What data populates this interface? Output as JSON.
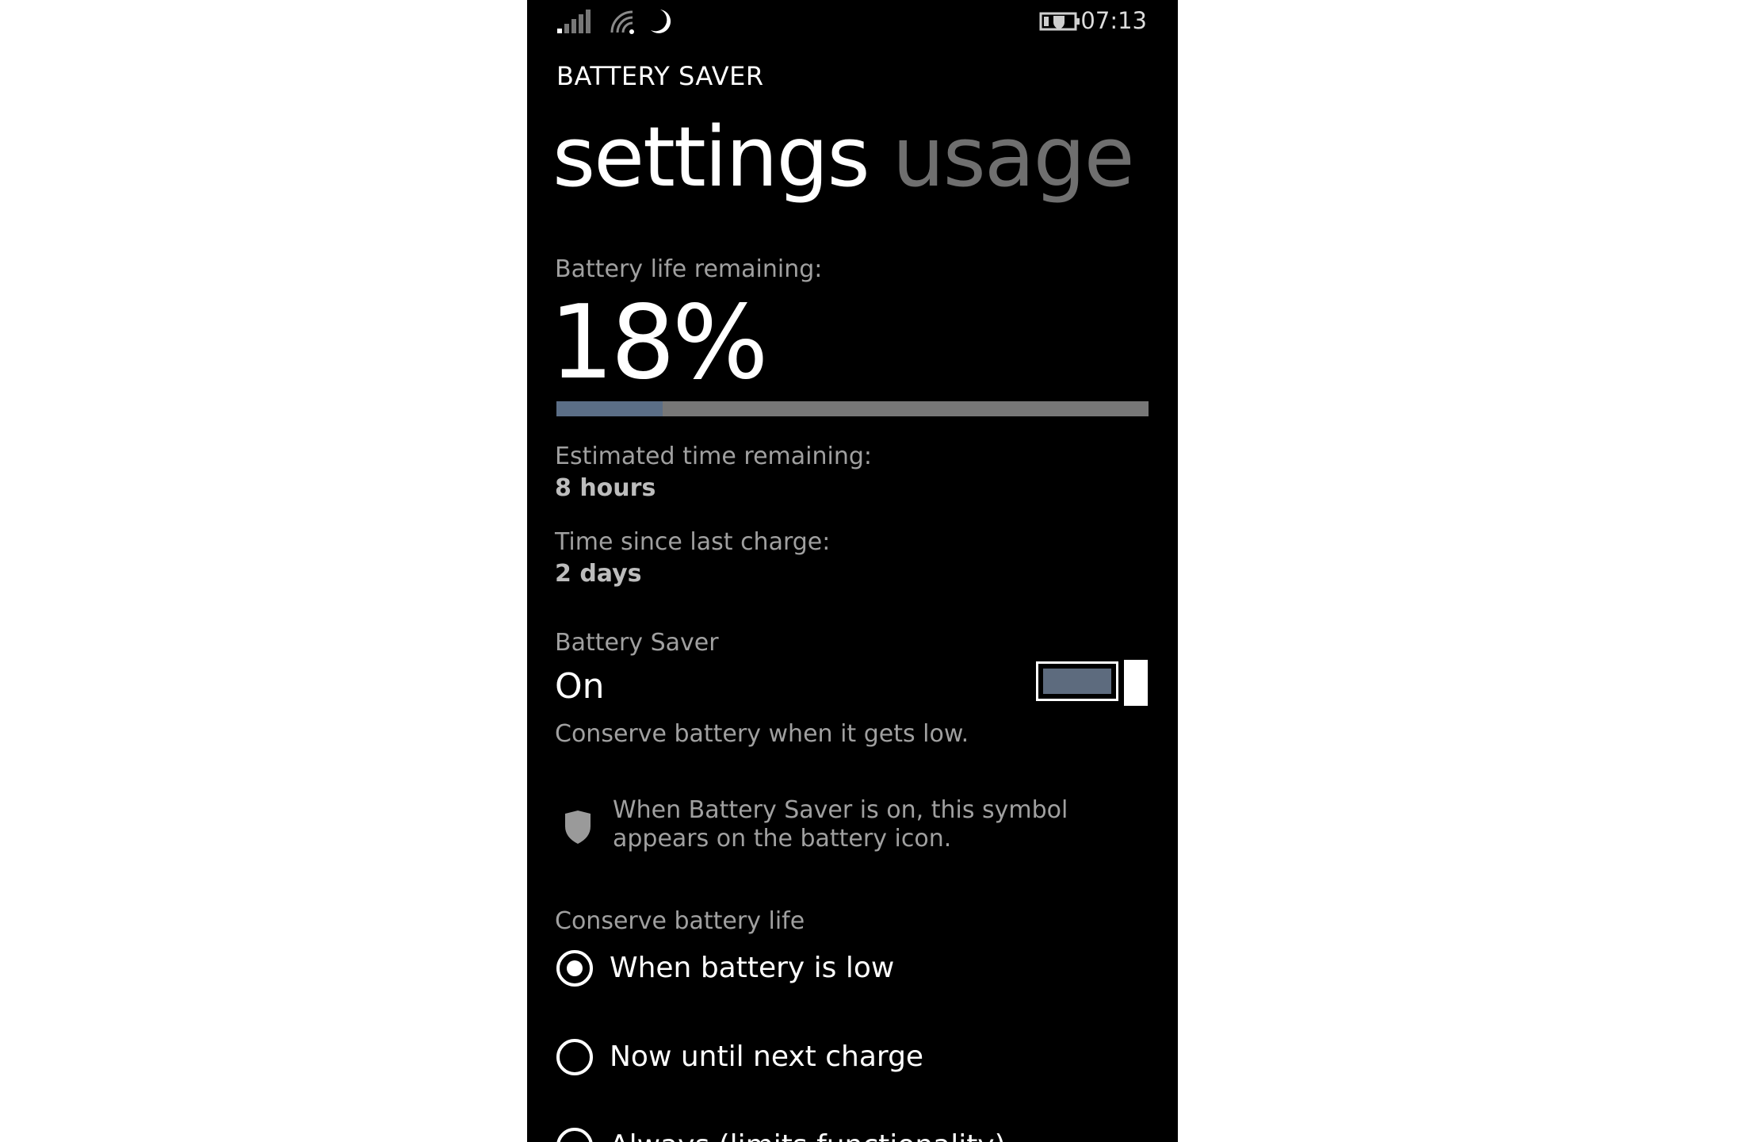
{
  "status_bar": {
    "time": "07:13",
    "icons": [
      "signal-strength-icon",
      "wifi-icon",
      "quiet-hours-moon-icon",
      "battery-saver-battery-icon"
    ]
  },
  "header": {
    "app_title": "BATTERY SAVER",
    "tabs": [
      {
        "label": "settings",
        "active": true
      },
      {
        "label": "usage",
        "active": false
      }
    ]
  },
  "battery": {
    "life_label": "Battery life remaining:",
    "percent_text": "18%",
    "level_fraction": 0.18,
    "estimated_label": "Estimated time remaining:",
    "estimated_value": "8 hours",
    "since_charge_label": "Time since last charge:",
    "since_charge_value": "2 days"
  },
  "saver": {
    "label": "Battery Saver",
    "state": "On",
    "description": "Conserve battery when it gets low.",
    "toggle_on": true,
    "info_icon": "shield-icon",
    "info_text": "When Battery Saver is on, this symbol appears on the battery icon."
  },
  "conserve": {
    "label": "Conserve battery life",
    "options": [
      {
        "label": "When battery is low",
        "selected": true
      },
      {
        "label": "Now until next charge",
        "selected": false
      },
      {
        "label": "Always (limits functionality)",
        "selected": false
      }
    ]
  },
  "colors": {
    "background": "#000000",
    "accent": "#5b6e86",
    "secondary_text": "#a0a0a0",
    "inactive_tab": "#6f6f6f"
  }
}
